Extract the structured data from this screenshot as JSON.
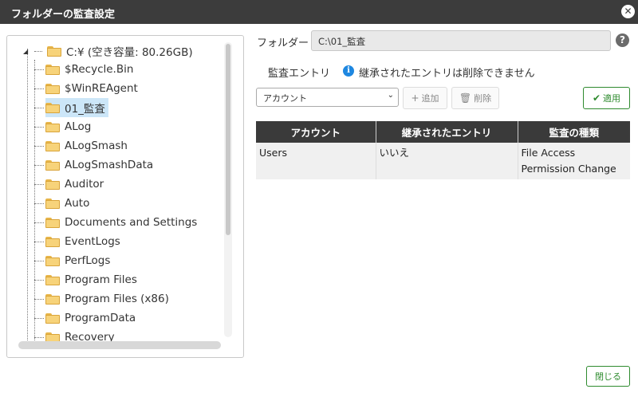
{
  "window": {
    "title": "フォルダーの監査設定",
    "close_icon": "close-icon"
  },
  "tree": {
    "root": {
      "label": "C:¥ (空き容量: 80.26GB)"
    },
    "items": [
      {
        "label": "$Recycle.Bin"
      },
      {
        "label": "$WinREAgent"
      },
      {
        "label": "01_監査",
        "selected": true
      },
      {
        "label": "ALog"
      },
      {
        "label": "ALogSmash"
      },
      {
        "label": "ALogSmashData"
      },
      {
        "label": "Auditor"
      },
      {
        "label": "Auto"
      },
      {
        "label": "Documents and Settings"
      },
      {
        "label": "EventLogs"
      },
      {
        "label": "PerfLogs"
      },
      {
        "label": "Program Files"
      },
      {
        "label": "Program Files (x86)"
      },
      {
        "label": "ProgramData"
      },
      {
        "label": "Recovery"
      }
    ]
  },
  "folder": {
    "label": "フォルダー",
    "path": "C:\\01_監査"
  },
  "audit": {
    "label": "監査エントリ",
    "note": "継承されたエントリは削除できません",
    "account_select": "アカウント",
    "add_label": "追加",
    "delete_label": "削除",
    "apply_label": "適用",
    "table": {
      "headers": [
        "アカウント",
        "継承されたエントリ",
        "監査の種類"
      ],
      "rows": [
        {
          "account": "Users",
          "inherited": "いいえ",
          "types": [
            "File Access",
            "Permission Change"
          ]
        }
      ]
    }
  },
  "footer": {
    "close_label": "閉じる"
  },
  "colors": {
    "titlebar": "#3c3c3c",
    "accent_green": "#2e8b2e",
    "info_blue": "#1e87e0",
    "selected": "#cce6f8"
  }
}
